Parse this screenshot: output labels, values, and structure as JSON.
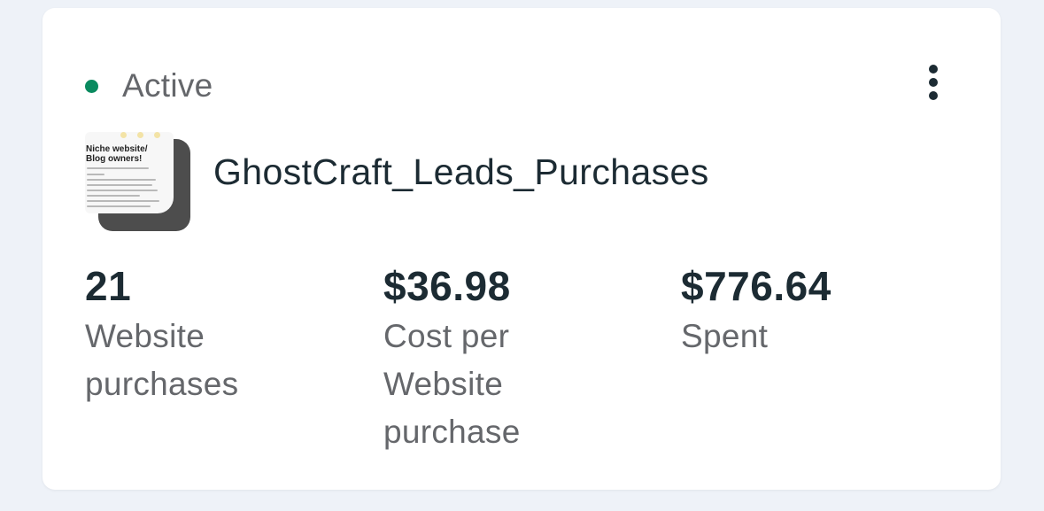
{
  "status": {
    "text": "Active",
    "color": "#0a8a5f"
  },
  "menu": {
    "icon": "more-vertical-icon"
  },
  "campaign": {
    "name": "GhostCraft_Leads_Purchases",
    "thumbnail_title": "Niche website/ Blog owners!"
  },
  "metrics": [
    {
      "value": "21",
      "label_lines": [
        "Website",
        "purchases"
      ]
    },
    {
      "value": "$36.98",
      "label_lines": [
        "Cost per",
        "Website",
        "purchase"
      ]
    },
    {
      "value": "$776.64",
      "label_lines": [
        "Spent"
      ]
    }
  ]
}
